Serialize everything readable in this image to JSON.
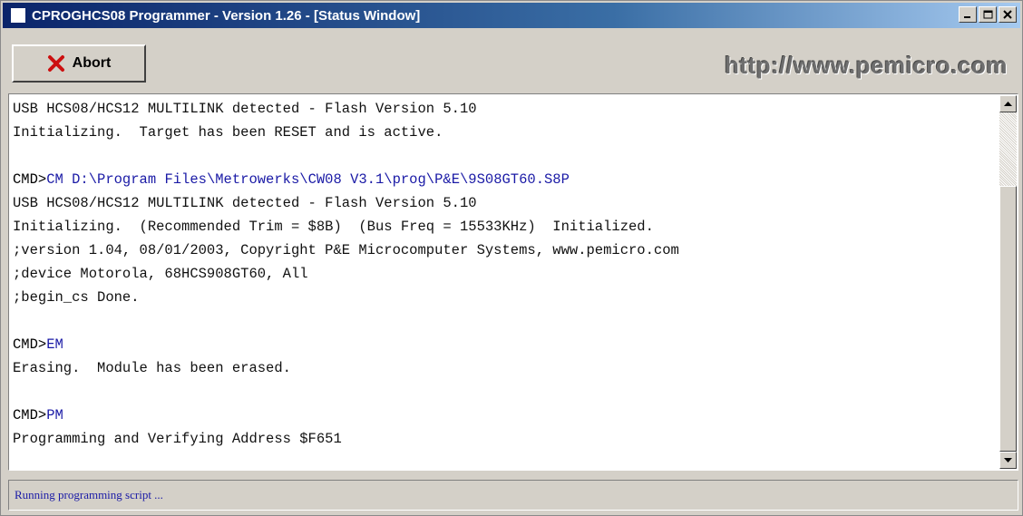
{
  "window": {
    "title": "CPROGHCS08 Programmer - Version 1.26 - [Status Window]",
    "minimize_icon": "minimize-icon",
    "maximize_icon": "maximize-icon",
    "close_icon": "close-icon"
  },
  "toolbar": {
    "abort_label": "Abort",
    "abort_icon": "red-x-icon",
    "url": "http://www.pemicro.com"
  },
  "log": {
    "lines": [
      {
        "type": "text",
        "text": "USB HCS08/HCS12 MULTILINK detected - Flash Version 5.10"
      },
      {
        "type": "text",
        "text": "Initializing.  Target has been RESET and is active."
      },
      {
        "type": "blank",
        "text": ""
      },
      {
        "type": "cmd",
        "prefix": "CMD>",
        "text": "CM D:\\Program Files\\Metrowerks\\CW08 V3.1\\prog\\P&E\\9S08GT60.S8P"
      },
      {
        "type": "text",
        "text": "USB HCS08/HCS12 MULTILINK detected - Flash Version 5.10"
      },
      {
        "type": "text",
        "text": "Initializing.  (Recommended Trim = $8B)  (Bus Freq = 15533KHz)  Initialized."
      },
      {
        "type": "text",
        "text": ";version 1.04, 08/01/2003, Copyright P&E Microcomputer Systems, www.pemicro.com"
      },
      {
        "type": "text",
        "text": ";device Motorola, 68HCS908GT60, All"
      },
      {
        "type": "text",
        "text": ";begin_cs Done."
      },
      {
        "type": "blank",
        "text": ""
      },
      {
        "type": "cmd",
        "prefix": "CMD>",
        "text": "EM"
      },
      {
        "type": "text",
        "text": "Erasing.  Module has been erased."
      },
      {
        "type": "blank",
        "text": ""
      },
      {
        "type": "cmd",
        "prefix": "CMD>",
        "text": "PM"
      },
      {
        "type": "text",
        "text": "Programming and Verifying Address $F651"
      }
    ]
  },
  "status": {
    "text": "Running programming script ..."
  },
  "colors": {
    "title_bar": "#0a246a",
    "command_text": "#1a1aa6",
    "abort_x": "#cc1010"
  }
}
